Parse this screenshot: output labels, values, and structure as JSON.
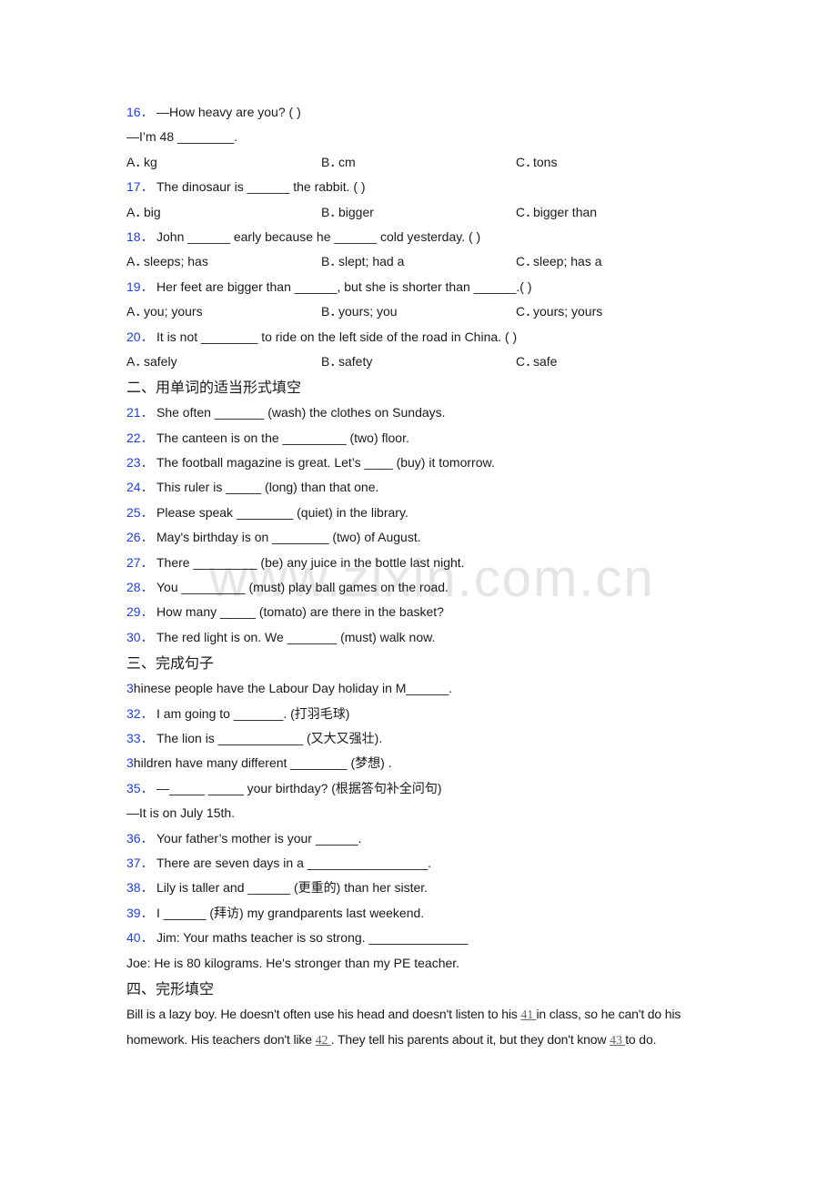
{
  "section1": {
    "questions": [
      {
        "num": "16．",
        "text": "—How heavy are you? (    )",
        "extra": "—I’m 48 ________.",
        "options": [
          "kg",
          "cm",
          "tons"
        ]
      },
      {
        "num": "17．",
        "text": "The dinosaur is ______ the rabbit. (   )",
        "options": [
          "big",
          "bigger",
          "bigger than"
        ]
      },
      {
        "num": "18．",
        "text": "John ______ early because he ______ cold yesterday. (   )",
        "options": [
          "sleeps; has",
          "slept; had a",
          "sleep; has a"
        ]
      },
      {
        "num": "19．",
        "text": "Her feet are bigger than ______, but she is shorter than ______.(    )",
        "options": [
          "you; yours",
          "yours; you",
          "yours; yours"
        ]
      },
      {
        "num": "20．",
        "text": "It is not ________ to ride on the left side of the road in China. (    )",
        "options": [
          "safely",
          "safety",
          "safe"
        ]
      }
    ],
    "option_labels": [
      "A．",
      "B．",
      "C．"
    ]
  },
  "section2": {
    "heading": "二、用单词的适当形式填空",
    "questions": [
      {
        "num": "21．",
        "text": "She often _______ (wash) the clothes on Sundays."
      },
      {
        "num": "22．",
        "text": "The canteen is on the _________ (two) floor."
      },
      {
        "num": "23．",
        "text": "The football magazine is great. Let’s ____ (buy) it tomorrow."
      },
      {
        "num": "24．",
        "text": "This ruler is _____ (long) than that one."
      },
      {
        "num": "25．",
        "text": "Please speak ________ (quiet) in the library."
      },
      {
        "num": "26．",
        "text": "May's birthday is on ________ (two) of August."
      },
      {
        "num": "27．",
        "text": "There _________ (be) any juice in the bottle last night."
      },
      {
        "num": "28．",
        "text": "You _________ (must) play ball games on the road."
      },
      {
        "num": "29．",
        "text": "How many _____ (tomato) are there in the basket?"
      },
      {
        "num": "30．",
        "text": "The red light is on. We _______ (must) walk now."
      }
    ]
  },
  "section3": {
    "heading": "三、完成句子",
    "q31": {
      "num": "3",
      "text": "hinese people have the Labour Day holiday in M______."
    },
    "q32": {
      "num": "32．",
      "text": "I am going to _______. (打羽毛球)"
    },
    "q33": {
      "num": "33．",
      "text": "The lion is ____________ (又大又强壮)."
    },
    "q34": {
      "num": "3",
      "text": "hildren have many different ________ (梦想) ."
    },
    "q35": {
      "num": "35．",
      "text": "—_____ _____ your birthday? (根据答句补全问句)",
      "extra": "—It is on July 15th."
    },
    "q36": {
      "num": "36．",
      "text": "Your father’s mother is your ______."
    },
    "q37": {
      "num": "37．",
      "text": "There are seven days in a _________________."
    },
    "q38": {
      "num": "38．",
      "text": "Lily is taller and ______ (更重的) than her sister."
    },
    "q39": {
      "num": "39．",
      "text": "I ______ (拜访) my grandparents last weekend."
    },
    "q40": {
      "num": "40．",
      "text": "Jim: Your maths teacher is so strong. ______________",
      "extra": "Joe: He is 80 kilograms. He's stronger than my PE teacher."
    }
  },
  "section4": {
    "heading": "四、完形填空",
    "p1": "Bill is a lazy boy. He doesn't often use his head and doesn't listen to his ",
    "b41": "  41   ",
    "p2": " in class, so he can't do his homework. His teachers don't like ",
    "b42": "  42   ",
    "p3": ". They tell his parents about it, but they don't know ",
    "b43": "  43   ",
    "p4": " to do."
  },
  "watermark": "www.zixin.com.cn"
}
